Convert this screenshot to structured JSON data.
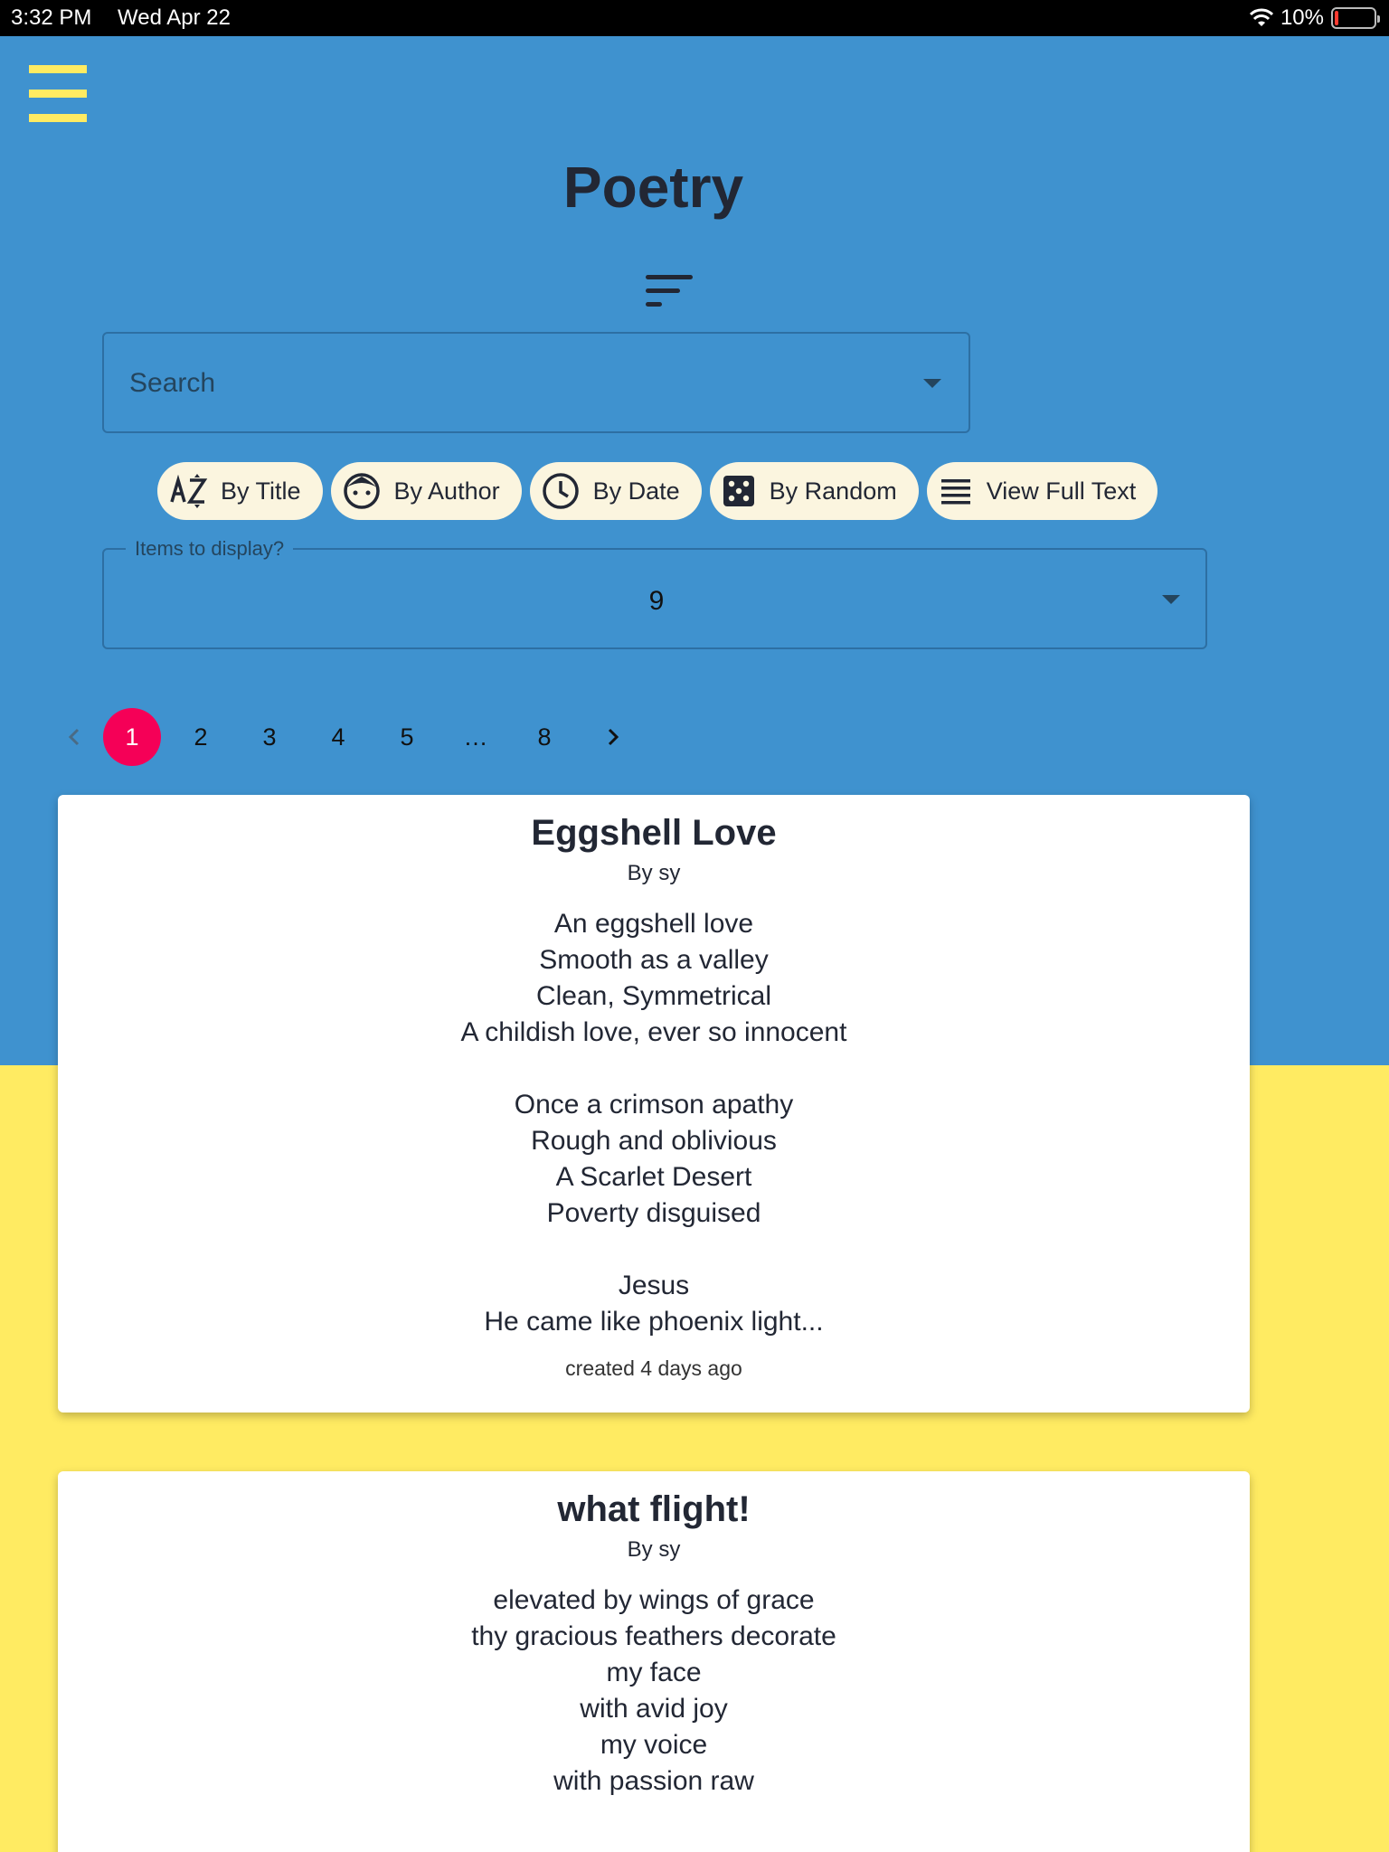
{
  "status_bar": {
    "time": "3:32 PM",
    "date": "Wed Apr 22",
    "battery": "10%"
  },
  "colors": {
    "background_top": "#3f92cf",
    "background_bottom": "#ffeb62",
    "accent": "#f50057",
    "chip": "#fbf5df"
  },
  "header": {
    "title": "Poetry"
  },
  "search": {
    "placeholder": "Search"
  },
  "filters": [
    {
      "label": "By Title",
      "icon": "sort-alpha-icon"
    },
    {
      "label": "By Author",
      "icon": "face-icon"
    },
    {
      "label": "By Date",
      "icon": "clock-icon"
    },
    {
      "label": "By Random",
      "icon": "dice-icon"
    },
    {
      "label": "View Full Text",
      "icon": "lines-icon"
    }
  ],
  "items_select": {
    "label": "Items to display?",
    "value": "9"
  },
  "pagination": {
    "pages": [
      "1",
      "2",
      "3",
      "4",
      "5",
      "…",
      "8"
    ],
    "current": "1"
  },
  "poems": [
    {
      "title": "Eggshell Love",
      "author": "By sy",
      "text": "An eggshell love\nSmooth as a valley\nClean, Symmetrical\nA childish love, ever so innocent\n\nOnce a crimson apathy\nRough and oblivious\nA Scarlet Desert\nPoverty disguised\n\nJesus\nHe came like phoenix light...",
      "created": "created 4 days ago"
    },
    {
      "title": "what flight!",
      "author": "By sy",
      "text": "elevated by wings of grace\nthy gracious feathers decorate\nmy face\nwith avid joy\nmy voice\nwith passion raw"
    }
  ]
}
